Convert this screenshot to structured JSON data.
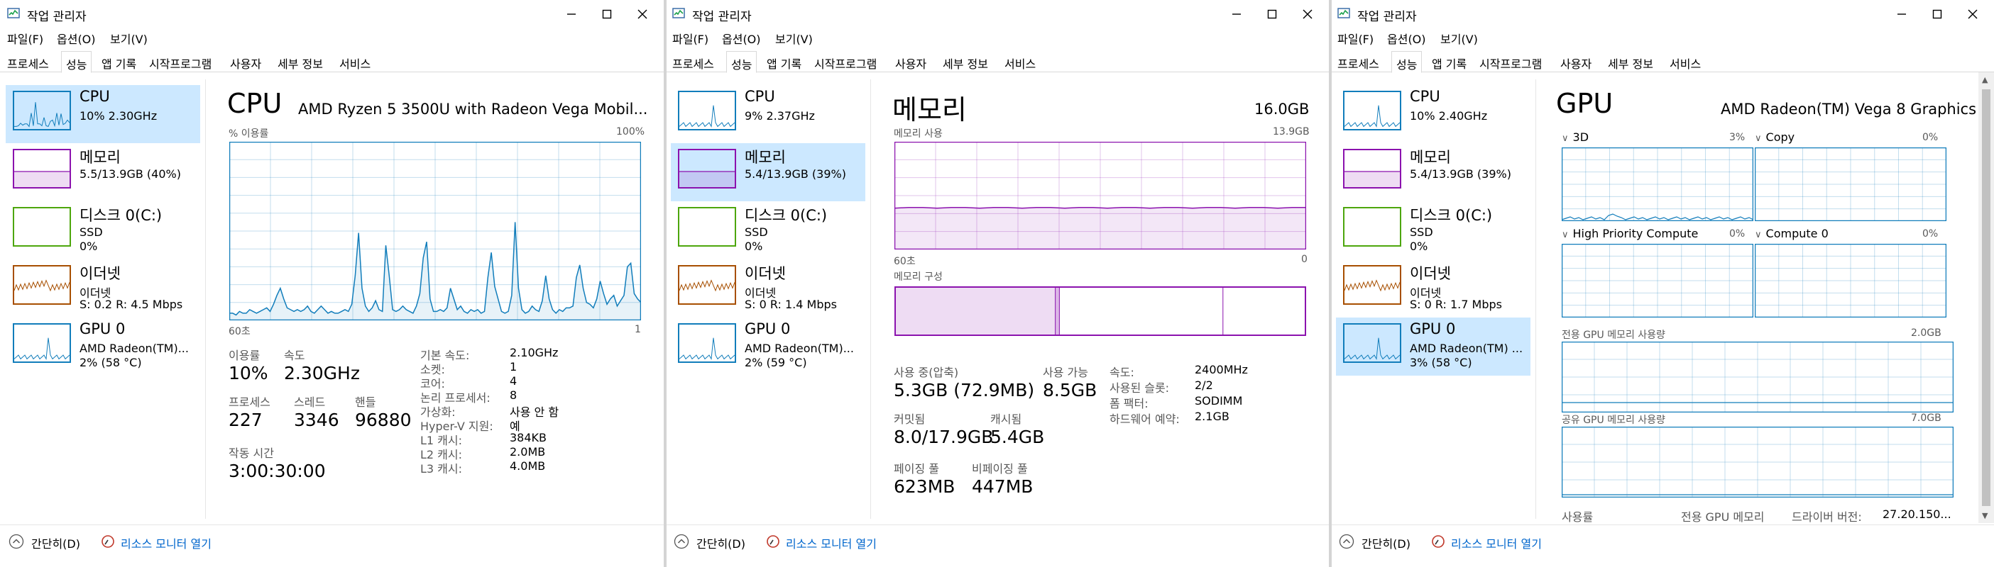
{
  "window": {
    "title": "작업 관리자",
    "menu": [
      "파일(F)",
      "옵션(O)",
      "보기(V)"
    ],
    "tabs": [
      "프로세스",
      "성능",
      "앱 기록",
      "시작프로그램",
      "사용자",
      "세부 정보",
      "서비스"
    ],
    "active_tab": "성능",
    "footer": {
      "less": "간단히(D)",
      "monitor": "리소스 모니터 열기"
    }
  },
  "colors": {
    "cpu": "#117dbb",
    "memory": "#8b12ae",
    "disk": "#4da60c",
    "ethernet": "#a74f01",
    "gpu": "#117dbb",
    "selected": "#cce8ff"
  },
  "icons": [
    "task-manager-icon",
    "minimize-icon",
    "maximize-icon",
    "close-icon",
    "collapse-chevron-icon",
    "resource-monitor-icon"
  ],
  "windows": [
    {
      "sidebar": [
        {
          "name": "CPU",
          "l2": "10% 2.30GHz",
          "l3": ""
        },
        {
          "name": "메모리",
          "l2": "5.5/13.9GB (40%)",
          "l3": ""
        },
        {
          "name": "디스크 0(C:)",
          "l2": "SSD",
          "l3": "0%"
        },
        {
          "name": "이더넷",
          "l2": "이더넷",
          "l3": "S: 0.2  R: 4.5 Mbps"
        },
        {
          "name": "GPU 0",
          "l2": "AMD Radeon(TM)...",
          "l3": "2% (58 °C)"
        }
      ],
      "cpu": {
        "title": "CPU",
        "model": "AMD Ryzen 5 3500U with Radeon Vega Mobil...",
        "graph_label": "% 이용률",
        "graph_max": "100%",
        "time_left": "60초",
        "time_right": "1",
        "usage_series": [
          4,
          4,
          3,
          5,
          4,
          4,
          6,
          5,
          4,
          5,
          6,
          7,
          5,
          9,
          14,
          18,
          12,
          7,
          6,
          5,
          6,
          5,
          6,
          8,
          5,
          4,
          6,
          8,
          6,
          4,
          5,
          4,
          4,
          5,
          6,
          5,
          9,
          25,
          49,
          18,
          8,
          5,
          7,
          11,
          6,
          5,
          42,
          25,
          6,
          5,
          6,
          8,
          6,
          5,
          4,
          8,
          15,
          35,
          44,
          12,
          5,
          5,
          6,
          5,
          7,
          18,
          12,
          6,
          8,
          5,
          4,
          6,
          5,
          6,
          4,
          5,
          24,
          38,
          19,
          12,
          5,
          4,
          5,
          14,
          55,
          18,
          6,
          4,
          5,
          8,
          6,
          5,
          11,
          25,
          12,
          6,
          4,
          6,
          5,
          7,
          7,
          8,
          24,
          31,
          18,
          10,
          9,
          7,
          12,
          22,
          15,
          9,
          12,
          14,
          8,
          11,
          14,
          30,
          32,
          15,
          12,
          10
        ],
        "stats": {
          "usage_label": "이용률",
          "usage": "10%",
          "speed_label": "속도",
          "speed": "2.30GHz",
          "proc_label": "프로세스",
          "proc": "227",
          "thread_label": "스레드",
          "thread": "3346",
          "handle_label": "핸들",
          "handle": "96880",
          "uptime_label": "작동 시간",
          "uptime": "3:00:30:00"
        },
        "props": [
          [
            "기본 속도:",
            "2.10GHz"
          ],
          [
            "소켓:",
            "1"
          ],
          [
            "코어:",
            "4"
          ],
          [
            "논리 프로세서:",
            "8"
          ],
          [
            "가상화:",
            "사용 안 함"
          ],
          [
            "Hyper-V 지원:",
            "예"
          ],
          [
            "L1 캐시:",
            "384KB"
          ],
          [
            "L2 캐시:",
            "2.0MB"
          ],
          [
            "L3 캐시:",
            "4.0MB"
          ]
        ]
      }
    },
    {
      "sidebar": [
        {
          "name": "CPU",
          "l2": "9% 2.37GHz",
          "l3": ""
        },
        {
          "name": "메모리",
          "l2": "5.4/13.9GB (39%)",
          "l3": ""
        },
        {
          "name": "디스크 0(C:)",
          "l2": "SSD",
          "l3": "0%"
        },
        {
          "name": "이더넷",
          "l2": "이더넷",
          "l3": "S: 0  R: 1.4 Mbps"
        },
        {
          "name": "GPU 0",
          "l2": "AMD Radeon(TM)...",
          "l3": "2% (59 °C)"
        }
      ],
      "memory": {
        "title": "메모리",
        "total": "16.0GB",
        "graph_label": "메모리 사용",
        "graph_max": "13.9GB",
        "time_left": "60초",
        "time_right": "0",
        "usage_fraction": 0.39,
        "composition_label": "메모리 구성",
        "composition": {
          "in_use": 0.39,
          "modified": 0.01,
          "standby": 0.4,
          "free": 0.2
        },
        "stats": {
          "inuse_label": "사용 중(압축)",
          "inuse": "5.3GB (72.9MB)",
          "avail_label": "사용 가능",
          "avail": "8.5GB",
          "commit_label": "커밋됨",
          "commit": "8.0/17.9GB",
          "cache_label": "캐시됨",
          "cache": "5.4GB",
          "paged_label": "페이징 풀",
          "paged": "623MB",
          "nonpaged_label": "비페이징 풀",
          "nonpaged": "447MB"
        },
        "props": [
          [
            "속도:",
            "2400MHz"
          ],
          [
            "사용된 슬롯:",
            "2/2"
          ],
          [
            "폼 팩터:",
            "SODIMM"
          ],
          [
            "하드웨어 예약:",
            "2.1GB"
          ]
        ]
      }
    },
    {
      "sidebar": [
        {
          "name": "CPU",
          "l2": "10% 2.40GHz",
          "l3": ""
        },
        {
          "name": "메모리",
          "l2": "5.4/13.9GB (39%)",
          "l3": ""
        },
        {
          "name": "디스크 0(C:)",
          "l2": "SSD",
          "l3": "0%"
        },
        {
          "name": "이더넷",
          "l2": "이더넷",
          "l3": "S: 0  R: 1.7 Mbps"
        },
        {
          "name": "GPU 0",
          "l2": "AMD Radeon(TM) ...",
          "l3": "3% (58 °C)"
        }
      ],
      "gpu": {
        "title": "GPU",
        "model": "AMD Radeon(TM) Vega 8 Graphics",
        "engines": [
          {
            "name": "3D",
            "pct": "3%"
          },
          {
            "name": "Copy",
            "pct": "0%"
          },
          {
            "name": "High Priority Compute",
            "pct": "0%"
          },
          {
            "name": "Compute 0",
            "pct": "0%"
          }
        ],
        "dedicated_label": "전용 GPU 메모리 사용량",
        "dedicated_max": "2.0GB",
        "shared_label": "공유 GPU 메모리 사용량",
        "shared_max": "7.0GB",
        "bottom_usage": "사용률",
        "bottom_dedicated": "전용 GPU 메모리",
        "bottom_driver_label": "드라이버 버전:",
        "bottom_driver": "27.20.150..."
      }
    }
  ]
}
